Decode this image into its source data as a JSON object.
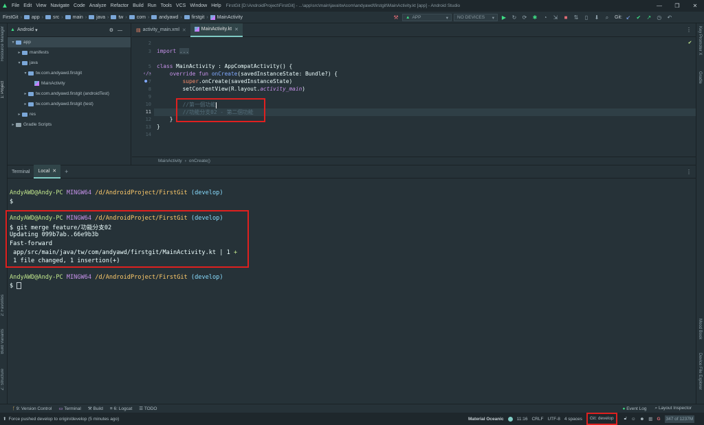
{
  "menubar": {
    "items": [
      "File",
      "Edit",
      "View",
      "Navigate",
      "Code",
      "Analyze",
      "Refactor",
      "Build",
      "Run",
      "Tools",
      "VCS",
      "Window",
      "Help"
    ],
    "title": "FirstGit [D:\\AndroidProject\\FirstGit] - ...\\app\\src\\main\\java\\tw\\com\\andyawd\\firstgit\\MainActivity.kt [app] - Android Studio"
  },
  "navbar": {
    "crumbs": [
      "FirstGit",
      "app",
      "src",
      "main",
      "java",
      "tw",
      "com",
      "andyawd",
      "firstgit",
      "MainActivity"
    ],
    "run_config": "APP",
    "devices": "NO DEVICES",
    "git_label": "Git:"
  },
  "project": {
    "view": "Android",
    "tree": [
      {
        "label": "app",
        "indent": 0,
        "arrow": "▾"
      },
      {
        "label": "manifests",
        "indent": 1,
        "arrow": "▸"
      },
      {
        "label": "java",
        "indent": 1,
        "arrow": "▾"
      },
      {
        "label": "tw.com.andyawd.firstgit",
        "indent": 2,
        "arrow": "▾"
      },
      {
        "label": "MainActivity",
        "indent": 3,
        "arrow": ""
      },
      {
        "label": "tw.com.andyawd.firstgit (androidTest)",
        "indent": 2,
        "arrow": "▸"
      },
      {
        "label": "tw.com.andyawd.firstgit (test)",
        "indent": 2,
        "arrow": "▸"
      },
      {
        "label": "res",
        "indent": 1,
        "arrow": "▸"
      },
      {
        "label": "Gradle Scripts",
        "indent": 0,
        "arrow": "▸"
      }
    ]
  },
  "tabs": [
    {
      "label": "activity_main.xml",
      "active": false
    },
    {
      "label": "MainActivity.kt",
      "active": true
    }
  ],
  "editor": {
    "line_numbers": [
      "2",
      "3",
      "5",
      "6",
      "7",
      "8",
      "9",
      "10",
      "11",
      "12",
      "13",
      "14"
    ],
    "import_kw": "import",
    "import_rest": "...",
    "l6_class": "class",
    "l6_rest": " MainActivity : AppCompatActivity() {",
    "l7_override": "override fun",
    "l7_name": "onCreate",
    "l7_rest": "(savedInstanceState: Bundle?) {",
    "l8_super": "super",
    "l8_rest": ".onCreate(savedInstanceState)",
    "l9_pre": "setContentView(R.layout.",
    "l9_it": "activity_main",
    "l9_post": ")",
    "l11": "//第一個功能",
    "l12": "//功能分支02 - 第二個功能",
    "l13": "}",
    "l14": "}",
    "breadcrumb": [
      "MainActivity",
      "onCreate()"
    ]
  },
  "terminal": {
    "tabs": [
      "Terminal",
      "Local"
    ],
    "user": "AndyAWD@Andy-PC",
    "shell": "MINGW64",
    "path": "/d/AndroidProject/FirstGit",
    "branch": "(develop)",
    "prompt": "$",
    "command": "$ git merge feature/功能分支02",
    "out1": "Updating 099b7ab..66e9b3b",
    "out2": "Fast-forward",
    "out3_pre": " app/src/main/java/tw/com/andyawd/firstgit/MainActivity.kt | 1 ",
    "out3_plus": "+",
    "out4": " 1 file changed, 1 insertion(+)"
  },
  "left_stripe": [
    "Resource Manager",
    "1: Project",
    "2: Favorites",
    "Build Variants",
    "Z: Structure"
  ],
  "right_stripe": [
    "Key Promoter X",
    "Gradle",
    "Mood Book",
    "Device File Explorer"
  ],
  "toolwindows": {
    "left": [
      "9: Version Control",
      "Terminal",
      "Build",
      "6: Logcat",
      "TODO"
    ],
    "right": [
      "Event Log",
      "Layout Inspector"
    ]
  },
  "status": {
    "message": "Force pushed develop to origin/develop (5 minutes ago)",
    "theme": "Material Oceanic",
    "position": "11:16",
    "line_sep": "CRLF",
    "encoding": "UTF-8",
    "indent": "4 spaces",
    "git": "Git: develop",
    "memory": "347 of 1237M"
  },
  "colors": {
    "accent": "#80cbc4",
    "highlight_box": "#e0201f",
    "bg": "#263238"
  }
}
